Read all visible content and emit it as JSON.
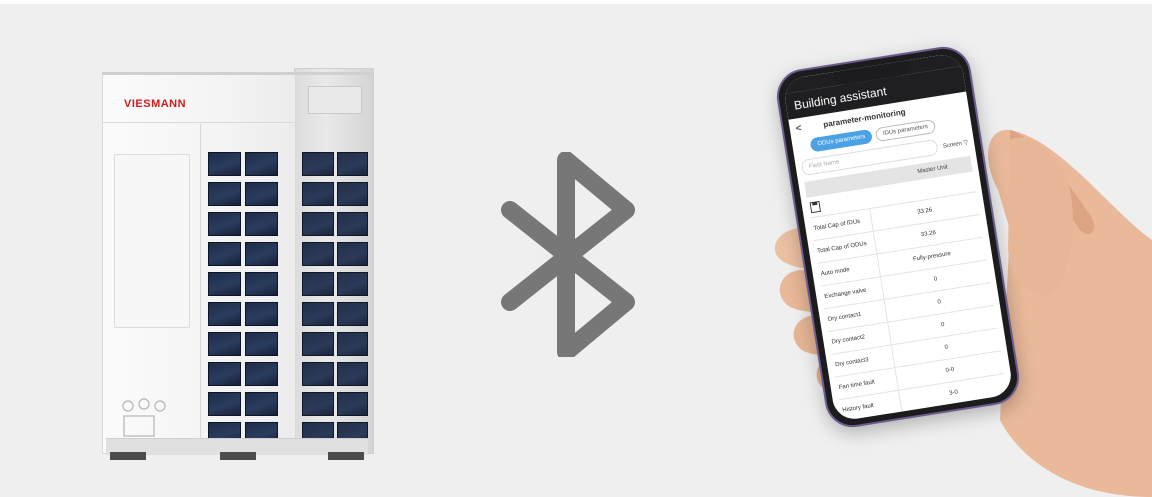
{
  "unit": {
    "brand": "VIESMANN"
  },
  "icons": {
    "connection": "bluetooth-icon",
    "save": "save-icon",
    "back": "back-arrow-icon",
    "filter": "filter-icon"
  },
  "colors": {
    "background": "#efeff0",
    "bluetooth": "#777777",
    "brand_red": "#d01c1c",
    "active_tab": "#4aa2e4",
    "grille": "#1d2c48"
  },
  "phone": {
    "app_title": "Building assistant",
    "page_title": "parameter-monitoring",
    "back_label": "<",
    "tabs": [
      {
        "label": "ODUs parameters",
        "active": true
      },
      {
        "label": "IDUs parameters",
        "active": false
      }
    ],
    "search_placeholder": "Field Name",
    "screen_button": "Screen",
    "table_header": "Master Unit",
    "rows": [
      {
        "name": "Total Cap of IDUs",
        "value": "33.26"
      },
      {
        "name": "Total Cap of ODUs",
        "value": "33.26"
      },
      {
        "name": "Auto mode",
        "value": "Fully-pressure"
      },
      {
        "name": "Exchange valve",
        "value": "0"
      },
      {
        "name": "Dry contact1",
        "value": "0"
      },
      {
        "name": "Dry contact2",
        "value": "0"
      },
      {
        "name": "Dry contact3",
        "value": "0"
      },
      {
        "name": "Fan time fault",
        "value": "0-0"
      },
      {
        "name": "History fault",
        "value": "3-0"
      }
    ]
  }
}
